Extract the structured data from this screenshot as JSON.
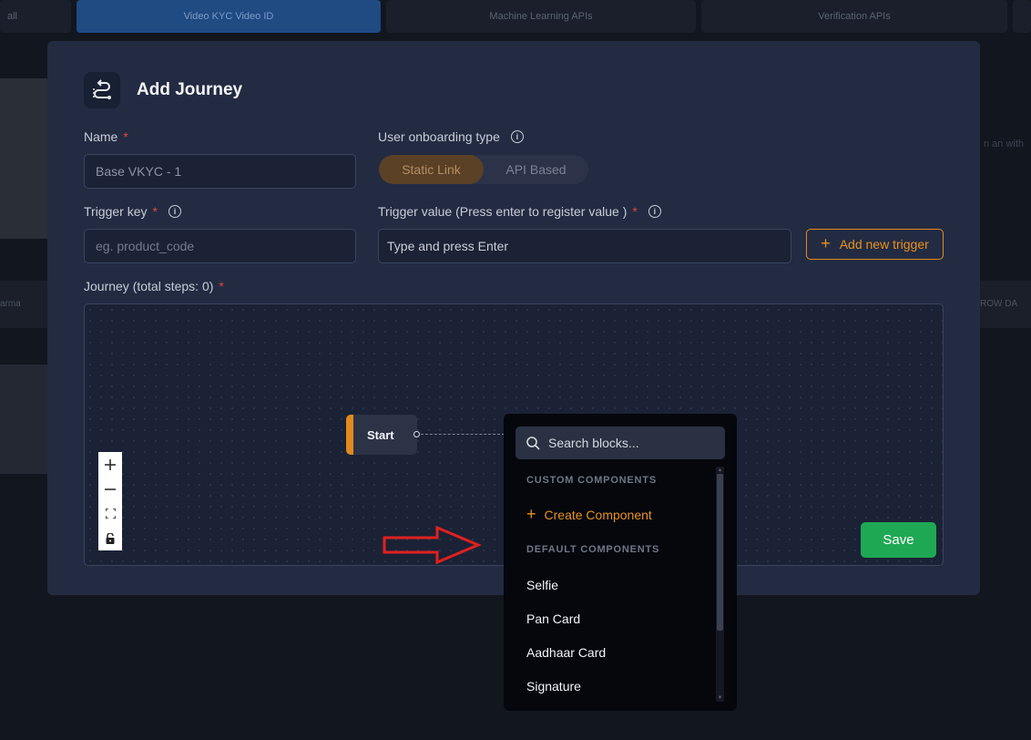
{
  "background": {
    "tabs": [
      "all",
      "Video KYC Video ID",
      "Machine Learning APIs",
      "Verification APIs",
      ""
    ],
    "side_label_left": "arma",
    "side_label_right": "ROW DA",
    "side_text_right": "n an with"
  },
  "modal": {
    "title": "Add Journey",
    "icon": "journey-route-icon",
    "name": {
      "label": "Name",
      "value": "Base VKYC - 1"
    },
    "onboarding": {
      "label": "User onboarding type",
      "options": [
        "Static Link",
        "API Based"
      ],
      "selected": "Static Link"
    },
    "trigger_key": {
      "label": "Trigger key",
      "placeholder": "eg. product_code"
    },
    "trigger_value": {
      "label": "Trigger value (Press enter to register value )",
      "placeholder": "Type and press Enter"
    },
    "add_trigger_label": "Add new trigger",
    "journey_label": "Journey (total steps: 0)",
    "canvas": {
      "start_node_label": "Start",
      "zoom_controls": [
        "+",
        "—",
        "⛶",
        "🔒"
      ]
    },
    "save_label": "Save"
  },
  "dropdown": {
    "search_placeholder": "Search blocks...",
    "custom_heading": "CUSTOM COMPONENTS",
    "create_label": "Create Component",
    "default_heading": "DEFAULT COMPONENTS",
    "items": [
      "Selfie",
      "Pan Card",
      "Aadhaar Card",
      "Signature"
    ]
  },
  "colors": {
    "accent": "#e8921f",
    "required": "#e0473d",
    "save": "#1fa854",
    "modal_bg": "#232b42",
    "annotation_arrow": "#e02020"
  }
}
